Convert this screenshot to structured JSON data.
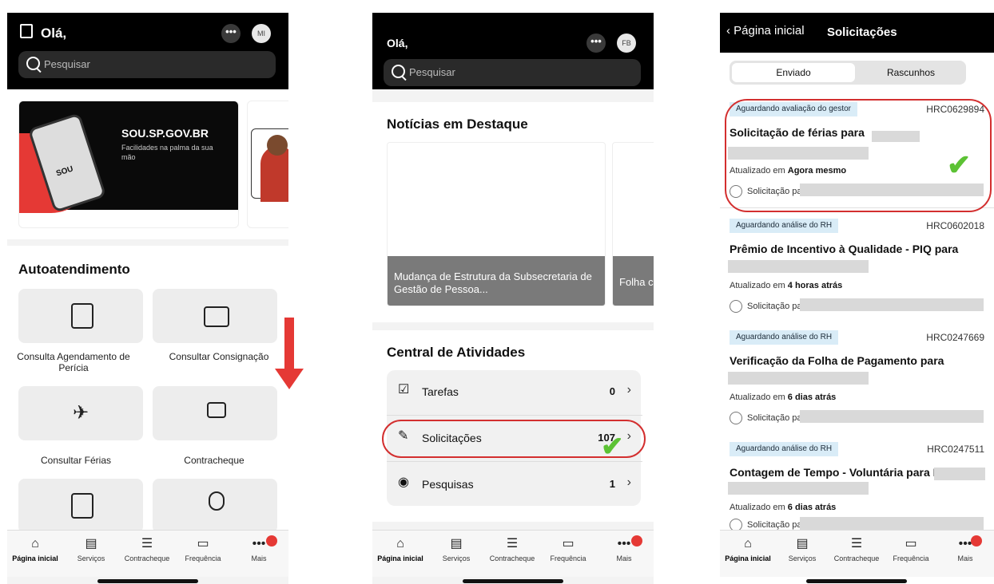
{
  "screen1": {
    "greeting": "Olá,",
    "avatar": "MI",
    "more": "•••",
    "search_placeholder": "Pesquisar",
    "banner": {
      "title": "SOU.SP.GOV.BR",
      "subtitle": "Facilidades na palma da sua mão",
      "logo": "SOU"
    },
    "section_title": "Autoatendimento",
    "tiles": [
      {
        "label": "Consulta Agendamento de Perícia",
        "icon": "clipboard-search-icon"
      },
      {
        "label": "Consultar Consignação",
        "icon": "screen-search-icon"
      },
      {
        "label": "Consultar Férias",
        "icon": "plane-check-icon"
      },
      {
        "label": "Contracheque",
        "icon": "hand-money-icon"
      },
      {
        "label": "",
        "icon": "document-plus-icon"
      },
      {
        "label": "",
        "icon": "medical-icon"
      }
    ]
  },
  "screen2": {
    "greeting": "Olá,",
    "avatar": "FB",
    "more": "•••",
    "search_placeholder": "Pesquisar",
    "news_title": "Notícias em Destaque",
    "news_card": "Mudança de Estrutura da Subsecretaria de Gestão de Pessoa...",
    "news_card2": "Folha c",
    "activities_title": "Central de Atividades",
    "activities": [
      {
        "label": "Tarefas",
        "count": "0",
        "icon": "clipboard-check-icon"
      },
      {
        "label": "Solicitações",
        "count": "107",
        "icon": "edit-icon"
      },
      {
        "label": "Pesquisas",
        "count": "1",
        "icon": "circle-check-icon"
      }
    ]
  },
  "screen3": {
    "back_label": "Página inicial",
    "title": "Solicitações",
    "seg_sent": "Enviado",
    "seg_drafts": "Rascunhos",
    "requests": [
      {
        "status": "Aguardando avaliação do gestor",
        "id": "HRC0629894",
        "title": "Solicitação de férias para",
        "updated_prefix": "Atualizado em ",
        "updated": "Agora mesmo",
        "for": "Solicitação para"
      },
      {
        "status": "Aguardando análise do RH",
        "id": "HRC0602018",
        "title": "Prêmio de Incentivo à Qualidade - PIQ para",
        "updated_prefix": "Atualizado em ",
        "updated": "4 horas atrás",
        "for": "Solicitação para"
      },
      {
        "status": "Aguardando análise do RH",
        "id": "HRC0247669",
        "title": "Verificação da Folha de Pagamento para",
        "updated_prefix": "Atualizado em ",
        "updated": "6 dias atrás",
        "for": "Solicitação para"
      },
      {
        "status": "Aguardando análise do RH",
        "id": "HRC0247511",
        "title": "Contagem de Tempo - Voluntária para I",
        "updated_prefix": "Atualizado em ",
        "updated": "6 dias atrás",
        "for": "Solicitação para"
      }
    ]
  },
  "tabbar": [
    {
      "label": "Página inicial",
      "icon": "home-icon"
    },
    {
      "label": "Serviços",
      "icon": "services-icon"
    },
    {
      "label": "Contracheque",
      "icon": "paycheck-icon"
    },
    {
      "label": "Frequência",
      "icon": "frequency-icon"
    },
    {
      "label": "Mais",
      "icon": "more-icon"
    }
  ],
  "colors": {
    "accent_red": "#d32f2f",
    "check_green": "#5cc234",
    "badge_blue": "#d9ecf7"
  }
}
